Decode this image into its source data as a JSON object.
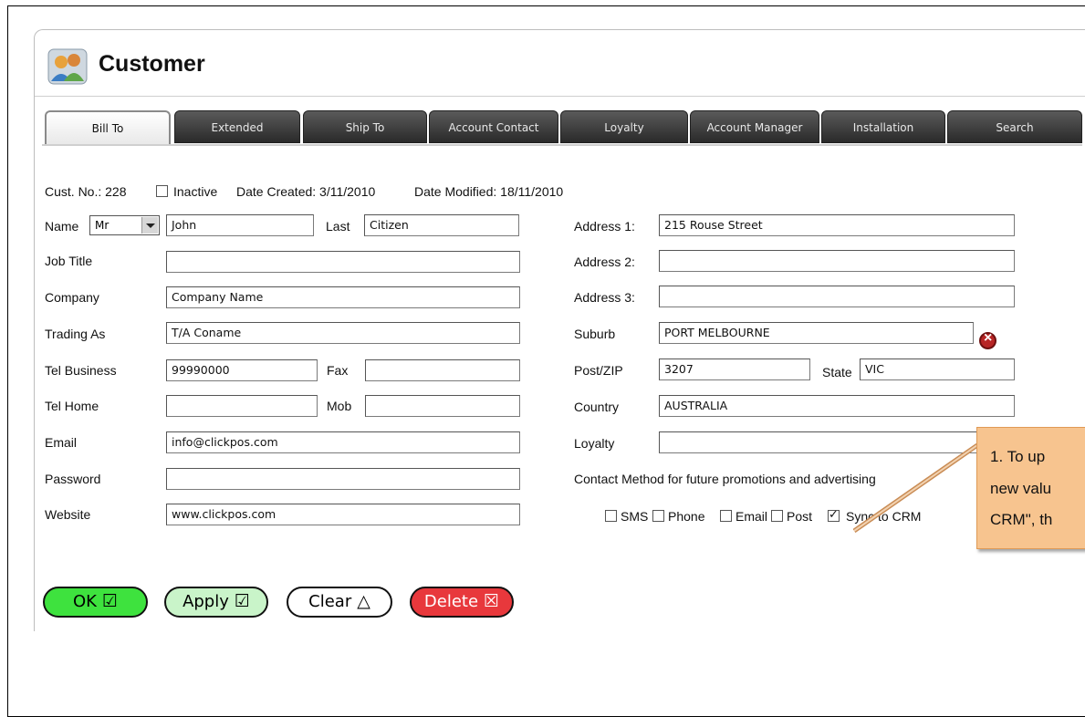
{
  "window": {
    "title": "Customer",
    "logo_icon": "customers-people-icon"
  },
  "tabs": [
    {
      "label": "Bill To",
      "active": true
    },
    {
      "label": "Extended"
    },
    {
      "label": "Ship To"
    },
    {
      "label": "Account Contact"
    },
    {
      "label": "Loyalty"
    },
    {
      "label": "Account Manager"
    },
    {
      "label": "Installation"
    },
    {
      "label": "Search"
    }
  ],
  "info": {
    "cust_no": "Cust. No.: 228",
    "inactive_label": "Inactive",
    "date_created": "Date Created: 3/11/2010",
    "date_modified": "Date Modified: 18/11/2010"
  },
  "form_left": {
    "name_label": "Name",
    "salutation": "Mr",
    "first_name": "John",
    "last_label": "Last",
    "last_name": "Citizen",
    "job_title_label": "Job Title",
    "job_title": "",
    "company_label": "Company",
    "company": "Company Name",
    "trading_as_label": "Trading As",
    "trading_as": "T/A Coname",
    "tel_business_label": "Tel Business",
    "tel_business": "99990000",
    "fax_label": "Fax",
    "fax": "",
    "tel_home_label": "Tel Home",
    "tel_home": "",
    "mob_label": "Mob",
    "mob": "",
    "email_label": "Email",
    "email": "info@clickpos.com",
    "password_label": "Password",
    "password": "",
    "website_label": "Website",
    "website": "www.clickpos.com"
  },
  "form_right": {
    "address1_label": "Address 1:",
    "address1": "215 Rouse Street",
    "address2_label": "Address 2:",
    "address2": "",
    "address3_label": "Address 3:",
    "address3": "",
    "suburb_label": "Suburb",
    "suburb": "PORT MELBOURNE",
    "postzip_label": "Post/ZIP",
    "postzip": "3207",
    "state_label": "State",
    "state": "VIC",
    "country_label": "Country",
    "country": "AUSTRALIA",
    "loyalty_label": "Loyalty",
    "loyalty": "",
    "contact_method_label": "Contact Method for future promotions and advertising"
  },
  "contact_options": [
    {
      "label": "SMS",
      "checked": false
    },
    {
      "label": "Phone",
      "checked": false
    },
    {
      "label": "Email",
      "checked": false
    },
    {
      "label": "Post",
      "checked": false
    },
    {
      "label": "Sync to CRM",
      "checked": true
    }
  ],
  "buttons": {
    "ok": "OK",
    "apply": "Apply",
    "clear": "Clear",
    "delete": "Delete",
    "ok_color": "#3ee23e",
    "apply_color": "#c9f4c9",
    "delete_color": "#e8383c"
  },
  "callout": {
    "line1": "1. To up",
    "line2": "new valu",
    "line3": "CRM\", th",
    "color": "#f7c48f"
  }
}
